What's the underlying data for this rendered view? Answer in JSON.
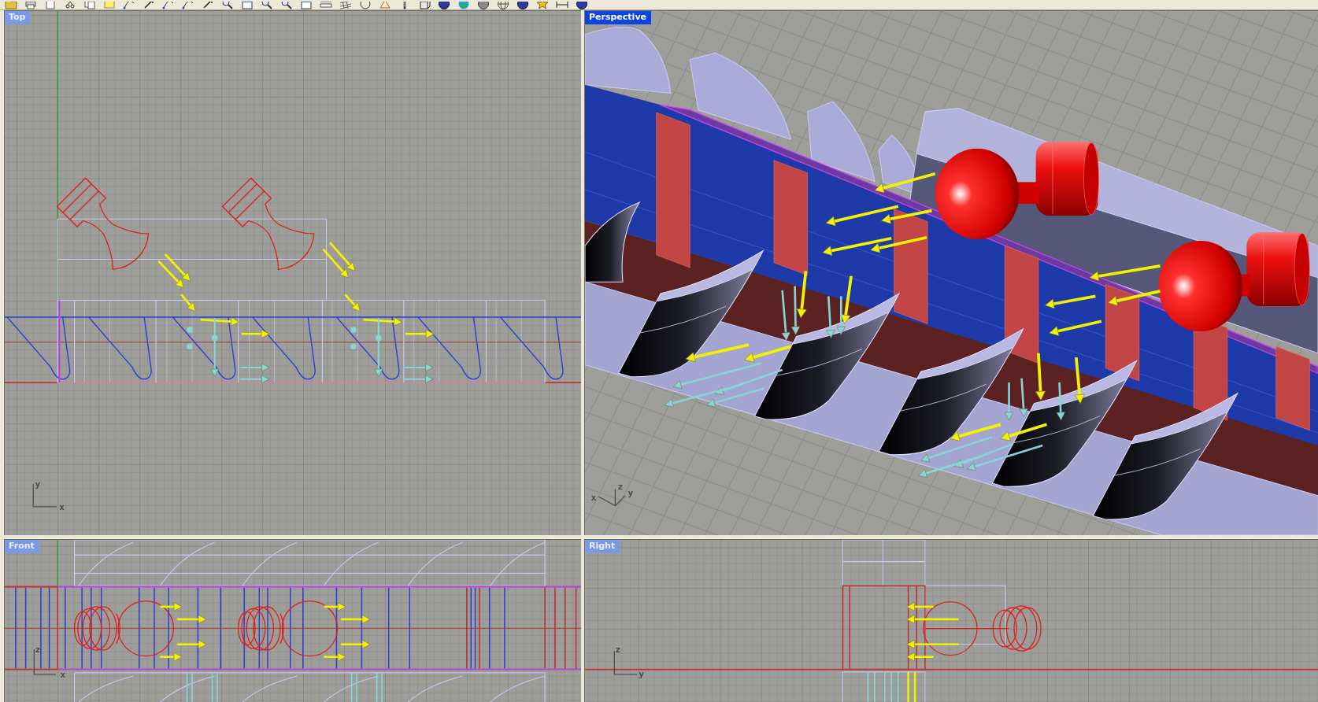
{
  "viewports": [
    {
      "title": "Top",
      "selected": false,
      "kind": "top",
      "axis_labels": [
        "y",
        "x"
      ]
    },
    {
      "title": "Perspective",
      "selected": true,
      "kind": "perspective",
      "axis_labels": [
        "x",
        "z",
        "y"
      ]
    },
    {
      "title": "Front",
      "selected": false,
      "kind": "front",
      "axis_labels": [
        "z",
        "x"
      ]
    },
    {
      "title": "Right",
      "selected": false,
      "kind": "right",
      "axis_labels": [
        "z",
        "y"
      ]
    }
  ]
}
